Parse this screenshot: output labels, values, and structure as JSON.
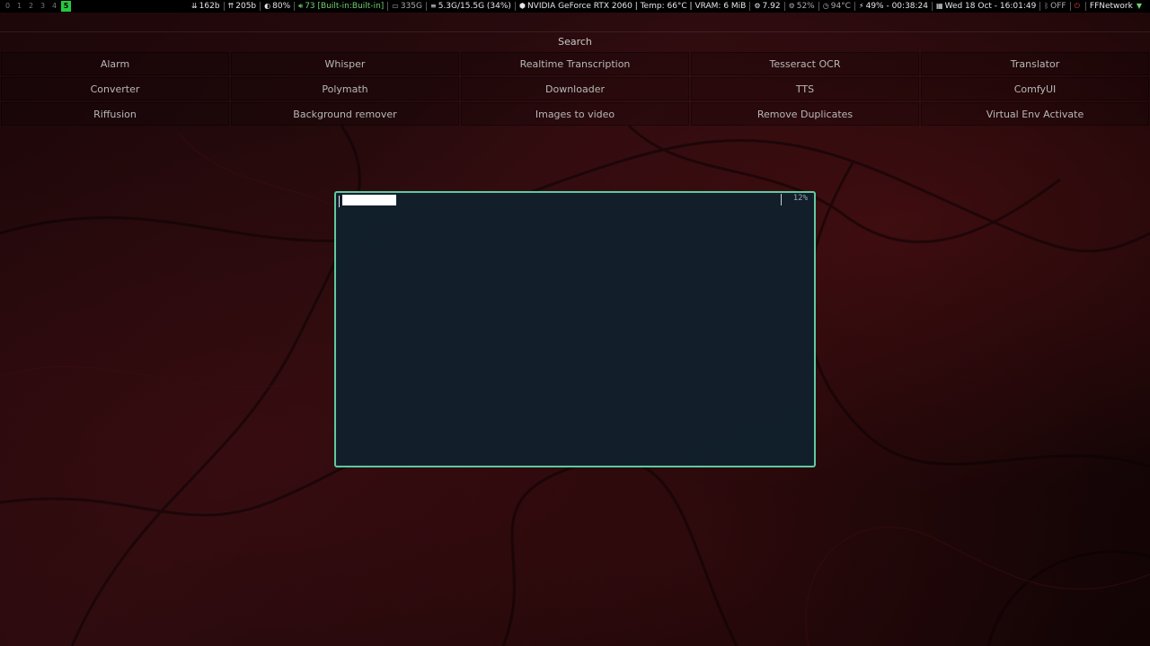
{
  "workspaces": {
    "items": [
      "0",
      "1",
      "2",
      "3",
      "4",
      "5"
    ],
    "active": "5"
  },
  "status": {
    "net_down": "162b",
    "net_up": "205b",
    "brightness": "80%",
    "volume": "73 [Built-in:Built-in]",
    "disk": "335G",
    "memory": "5.3G/15.5G (34%)",
    "gpu": "NVIDIA GeForce RTX 2060 | Temp: 66°C | VRAM: 6 MiB",
    "load": "7.92",
    "cpu": "52%",
    "temp": "94°C",
    "battery": "49% - 00:38:24",
    "datetime": "Wed 18 Oct - 16:01:49",
    "bluetooth": "OFF",
    "network": "FFNetwork"
  },
  "launcher": {
    "search_label": "Search",
    "rows": [
      [
        "Alarm",
        "Whisper",
        "Realtime Transcription",
        "Tesseract OCR",
        "Translator"
      ],
      [
        "Converter",
        "Polymath",
        "Downloader",
        "TTS",
        "ComfyUI"
      ],
      [
        "Riffusion",
        "Background remover",
        "Images to video",
        "Remove Duplicates",
        "Virtual Env Activate"
      ]
    ]
  },
  "terminal": {
    "progress": "12%"
  },
  "colors": {
    "accent_green": "#27c93f",
    "terminal_border": "#5fc9a0",
    "terminal_bg": "#11202d"
  }
}
